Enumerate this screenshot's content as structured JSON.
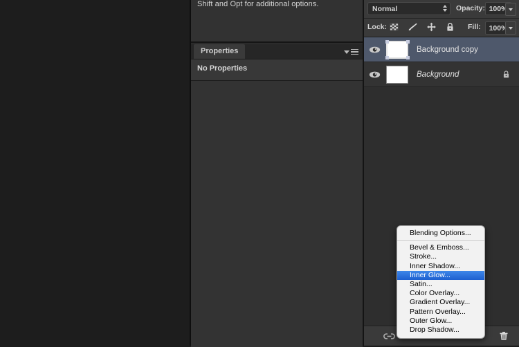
{
  "hint": {
    "text": "Shift and Opt for additional options."
  },
  "properties_panel": {
    "tab_label": "Properties",
    "empty_state": "No Properties",
    "panel_menu_icon": "panel-menu-icon"
  },
  "layers_panel": {
    "blend_mode": "Normal",
    "opacity_label": "Opacity:",
    "opacity_value": "100%",
    "lock_label": "Lock:",
    "fill_label": "Fill:",
    "fill_value": "100%",
    "lock_icons": [
      "lock-transparent-pixels-icon",
      "lock-image-pixels-icon",
      "lock-position-icon",
      "lock-all-icon"
    ],
    "layers": [
      {
        "name": "Background copy",
        "visible": true,
        "selected": true,
        "locked": false,
        "italic": false
      },
      {
        "name": "Background",
        "visible": true,
        "selected": false,
        "locked": true,
        "italic": true
      }
    ],
    "footer_icons": [
      "link-layers-icon",
      "delete-layer-icon"
    ]
  },
  "context_menu": {
    "items": [
      {
        "label": "Blending Options...",
        "highlighted": false,
        "separator_after": true
      },
      {
        "label": "Bevel & Emboss...",
        "highlighted": false,
        "separator_after": false
      },
      {
        "label": "Stroke...",
        "highlighted": false,
        "separator_after": false
      },
      {
        "label": "Inner Shadow...",
        "highlighted": false,
        "separator_after": false
      },
      {
        "label": "Inner Glow...",
        "highlighted": true,
        "separator_after": false
      },
      {
        "label": "Satin...",
        "highlighted": false,
        "separator_after": false
      },
      {
        "label": "Color Overlay...",
        "highlighted": false,
        "separator_after": false
      },
      {
        "label": "Gradient Overlay...",
        "highlighted": false,
        "separator_after": false
      },
      {
        "label": "Pattern Overlay...",
        "highlighted": false,
        "separator_after": false
      },
      {
        "label": "Outer Glow...",
        "highlighted": false,
        "separator_after": false
      },
      {
        "label": "Drop Shadow...",
        "highlighted": false,
        "separator_after": false
      }
    ]
  },
  "colors": {
    "selection_blue": "#3d86e8",
    "layer_selected": "#4e586b",
    "panel_bg": "#323232",
    "canvas_bg": "#1d1d1d"
  }
}
